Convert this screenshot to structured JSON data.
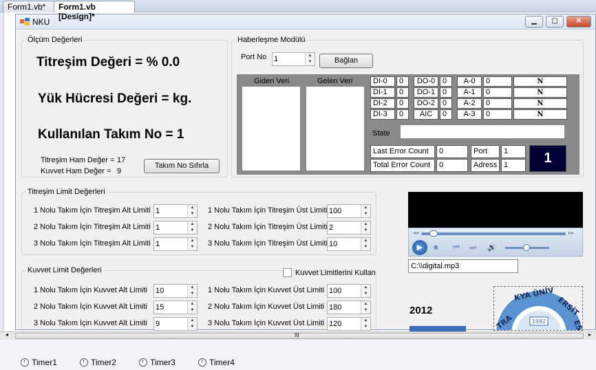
{
  "tabs": [
    "Form1.vb*",
    "Form1.vb [Design]*"
  ],
  "form": {
    "title": "NKU"
  },
  "olcum": {
    "legend": "Ölçüm Değerleri",
    "titresim": "Titreşim Değeri = %  0.0",
    "yuk": "Yük Hücresi Değeri = kg.",
    "takim": "Kullanılan Takım No =   1",
    "titresim_ham_label": "Titreşim Ham Değer =",
    "titresim_ham_value": "17",
    "kuvvet_ham_label": "Kuvvet Ham Değer =",
    "kuvvet_ham_value": "9",
    "reset_button": "Takım No Sıfırla"
  },
  "haberlesme": {
    "legend": "Haberleşme Modülü",
    "port_label": "Port No",
    "port_value": "1",
    "connect_button": "Bağlan",
    "giden": "Giden Veri",
    "gelen": "Gelen Veri",
    "di": [
      [
        "DI-0",
        "0"
      ],
      [
        "DI-1",
        "0"
      ],
      [
        "DI-2",
        "0"
      ],
      [
        "DI-3",
        "0"
      ]
    ],
    "do": [
      [
        "DO-0",
        "0"
      ],
      [
        "DO-1",
        "0"
      ],
      [
        "DO-2",
        "0"
      ],
      [
        "AIC",
        "0"
      ]
    ],
    "a": [
      [
        "A-0",
        "0",
        "N"
      ],
      [
        "A-1",
        "0",
        "N"
      ],
      [
        "A-2",
        "0",
        "N"
      ],
      [
        "A-3",
        "0",
        "N"
      ]
    ],
    "state_label": "State",
    "state_value": "",
    "last_error_label": "Last Error Count",
    "last_error_value": "0",
    "total_error_label": "Total Error Count",
    "total_error_value": "0",
    "port2_label": "Port",
    "port2_value": "1",
    "adress_label": "Adress",
    "adress_value": "1",
    "display": "1"
  },
  "titresim_limit": {
    "legend": "Titreşim Limit Değerleri",
    "rows": [
      {
        "alt_label": "1 Nolu Takım İçin Titreşim Alt Limiti",
        "alt": "1",
        "ust_label": "1 Nolu Takım İçin Titreşim Üst Limiti",
        "ust": "100"
      },
      {
        "alt_label": "2 Nolu Takım İçin Titreşim Alt Limiti",
        "alt": "1",
        "ust_label": "2 Nolu Takım İçin Titreşim Üst Limiti",
        "ust": "2"
      },
      {
        "alt_label": "3 Nolu Takım İçin Titreşim Alt Limiti",
        "alt": "1",
        "ust_label": "3 Nolu Takım İçin Titreşim Üst Limiti",
        "ust": "10"
      }
    ]
  },
  "kuvvet_limit": {
    "legend": "Kuvvet Limit Değerleri",
    "checkbox_label": "Kuvvet Limitlerini Kullan",
    "rows": [
      {
        "alt_label": "1 Nolu Takım İçin Kuvvet Alt Limiti",
        "alt": "10",
        "ust_label": "1 Nolu Takım İçin Kuvvet Üst Limiti",
        "ust": "100"
      },
      {
        "alt_label": "2 Nolu Takım İçin Kuvvet Alt Limiti",
        "alt": "15",
        "ust_label": "2 Nolu Takım İçin Kuvvet Üst Limiti",
        "ust": "180"
      },
      {
        "alt_label": "3 Nolu Takım İçin Kuvvet Alt Limiti",
        "alt": "9",
        "ust_label": "3 Nolu Takım İçin Kuvvet Üst Limiti",
        "ust": "120"
      }
    ]
  },
  "media": {
    "file": "C:\\\\digital.mp3"
  },
  "year": "2012",
  "logo_text": "TRAKYA ÜNİVERSİTESİ",
  "logo_year": "1982",
  "scroll_grip": "III",
  "timers": [
    "Timer1",
    "Timer2",
    "Timer3",
    "Timer4"
  ],
  "colors": {
    "display_bg": "#000033",
    "accent": "#3a6fb5"
  }
}
